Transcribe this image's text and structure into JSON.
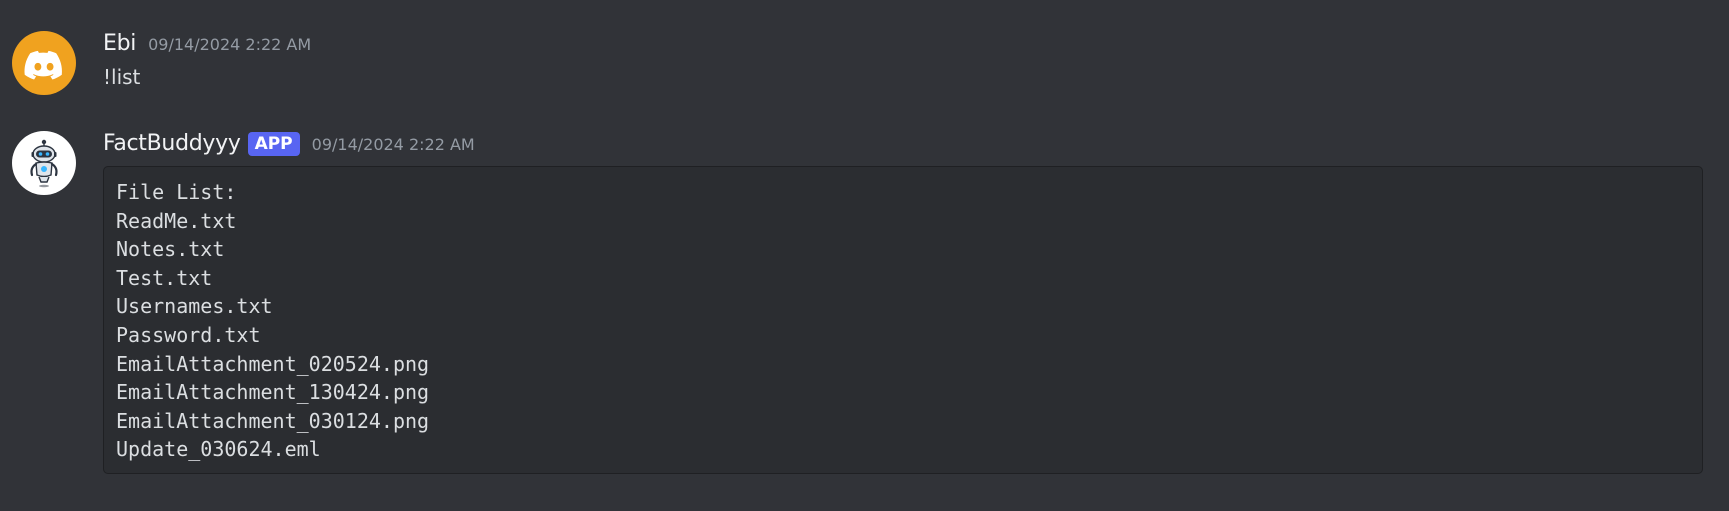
{
  "messages": [
    {
      "author": "Ebi",
      "timestamp": "09/14/2024 2:22 AM",
      "text": "!list",
      "avatar_icon": "discord-logo-icon",
      "avatar_color": "#f0a21f"
    },
    {
      "author": "FactBuddyyy",
      "badge": "APP",
      "timestamp": "09/14/2024 2:22 AM",
      "avatar_icon": "robot-icon",
      "avatar_color": "#ffffff",
      "code_lines": [
        "File List:",
        "ReadMe.txt",
        "Notes.txt",
        "Test.txt",
        "Usernames.txt",
        "Password.txt",
        "EmailAttachment_020524.png",
        "EmailAttachment_130424.png",
        "EmailAttachment_030124.png",
        "Update_030624.eml"
      ]
    }
  ],
  "colors": {
    "background": "#313338",
    "codeblock_bg": "#2b2d31",
    "badge": "#5865f2",
    "timestamp": "#949ba4"
  }
}
